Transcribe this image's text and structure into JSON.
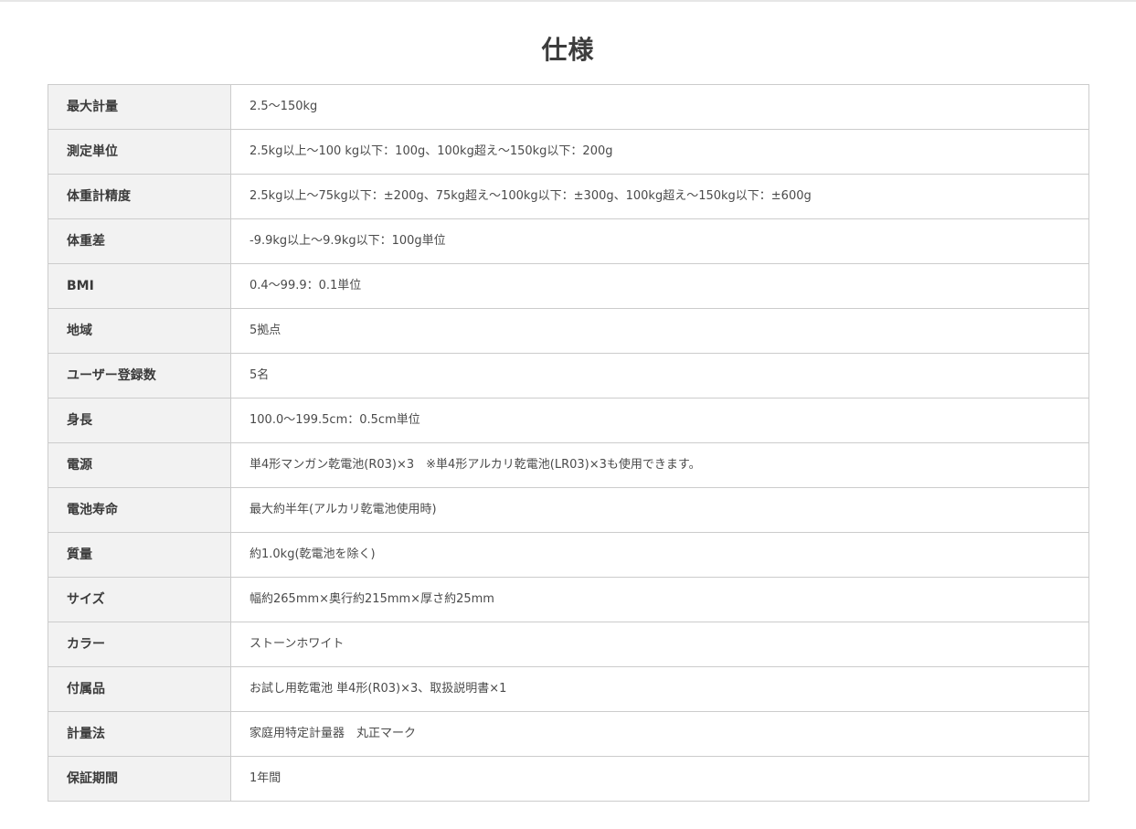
{
  "title": "仕様",
  "specs": [
    {
      "label": "最大計量",
      "value": "2.5～150kg"
    },
    {
      "label": "測定単位",
      "value": "2.5kg以上～100 kg以下：100g、100kg超え～150kg以下：200g"
    },
    {
      "label": "体重計精度",
      "value": "2.5kg以上～75kg以下：±200g、75kg超え～100kg以下：±300g、100kg超え～150kg以下：±600g"
    },
    {
      "label": "体重差",
      "value": "-9.9kg以上～9.9kg以下：100g単位"
    },
    {
      "label": "BMI",
      "value": "0.4～99.9：0.1単位"
    },
    {
      "label": "地域",
      "value": "5拠点"
    },
    {
      "label": "ユーザー登録数",
      "value": "5名"
    },
    {
      "label": "身長",
      "value": "100.0～199.5cm：0.5cm単位"
    },
    {
      "label": "電源",
      "value": "単4形マンガン乾電池(R03)×3　※単4形アルカリ乾電池(LR03)×3も使用できます。"
    },
    {
      "label": "電池寿命",
      "value": "最大約半年(アルカリ乾電池使用時)"
    },
    {
      "label": "質量",
      "value": "約1.0kg(乾電池を除く)"
    },
    {
      "label": "サイズ",
      "value": "幅約265mm×奥行約215mm×厚さ約25mm"
    },
    {
      "label": "カラー",
      "value": "ストーンホワイト"
    },
    {
      "label": "付属品",
      "value": "お試し用乾電池 単4形(R03)×3、取扱説明書×1"
    },
    {
      "label": "計量法",
      "value": "家庭用特定計量器　丸正マーク"
    },
    {
      "label": "保証期間",
      "value": "1年間"
    }
  ]
}
